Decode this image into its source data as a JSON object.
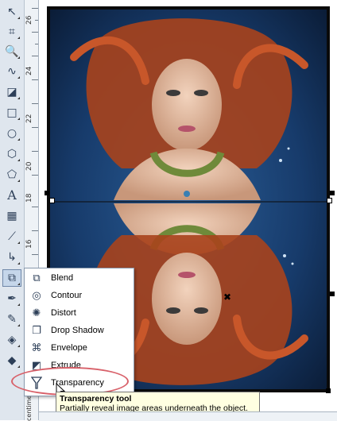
{
  "toolbox": {
    "tools": [
      {
        "name": "pick-tool",
        "icon": "pick-icon",
        "glyph": "↖"
      },
      {
        "name": "crop-tool",
        "icon": "crop-icon",
        "glyph": "⌗"
      },
      {
        "name": "zoom-tool",
        "icon": "zoom-icon",
        "glyph": "🔍"
      },
      {
        "name": "freehand-tool",
        "icon": "freehand-icon",
        "glyph": "∿"
      },
      {
        "name": "smart-fill-tool",
        "icon": "smart-fill-icon",
        "glyph": "◪"
      },
      {
        "name": "rectangle-tool",
        "icon": "rectangle-icon",
        "glyph": "□"
      },
      {
        "name": "ellipse-tool",
        "icon": "ellipse-icon",
        "glyph": "○"
      },
      {
        "name": "polygon-tool",
        "icon": "polygon-icon",
        "glyph": "⬡"
      },
      {
        "name": "basic-shapes-tool",
        "icon": "basic-shapes-icon",
        "glyph": "⬠"
      },
      {
        "name": "text-tool",
        "icon": "text-icon",
        "glyph": "A"
      },
      {
        "name": "table-tool",
        "icon": "table-icon",
        "glyph": "▦"
      },
      {
        "name": "dimension-tool",
        "icon": "dimension-icon",
        "glyph": "⟋"
      },
      {
        "name": "connector-tool",
        "icon": "connector-icon",
        "glyph": "↳"
      },
      {
        "name": "interactive-effects-tool",
        "icon": "blend-icon",
        "glyph": "⧉"
      },
      {
        "name": "eyedropper-tool",
        "icon": "eyedropper-icon",
        "glyph": "✒"
      },
      {
        "name": "outline-tool",
        "icon": "outline-pen-icon",
        "glyph": "✎"
      },
      {
        "name": "fill-tool",
        "icon": "fill-bucket-icon",
        "glyph": "◈"
      },
      {
        "name": "interactive-fill-tool",
        "icon": "interactive-fill-icon",
        "glyph": "◆"
      }
    ]
  },
  "ruler": {
    "labels": [
      "26",
      "24",
      "22",
      "20",
      "18",
      "16"
    ],
    "unit_label": "centimeters"
  },
  "flyout_menu": {
    "items": [
      {
        "label": "Blend",
        "icon": "blend-icon",
        "glyph": "⧉"
      },
      {
        "label": "Contour",
        "icon": "contour-icon",
        "glyph": "◎"
      },
      {
        "label": "Distort",
        "icon": "distort-icon",
        "glyph": "✺"
      },
      {
        "label": "Drop Shadow",
        "icon": "drop-shadow-icon",
        "glyph": "❐"
      },
      {
        "label": "Envelope",
        "icon": "envelope-icon",
        "glyph": "⌘"
      },
      {
        "label": "Extrude",
        "icon": "extrude-icon",
        "glyph": "◩"
      },
      {
        "label": "Transparency",
        "icon": "transparency-icon",
        "glyph": "𝕐"
      }
    ]
  },
  "tooltip": {
    "title": "Transparency tool",
    "description": "Partially reveal image areas underneath the object."
  },
  "colors": {
    "highlight": "#d8616a",
    "tooltip_bg": "#ffffe1",
    "toolbox_bg": "#dfe6ee",
    "photo_background": "#14305a"
  }
}
